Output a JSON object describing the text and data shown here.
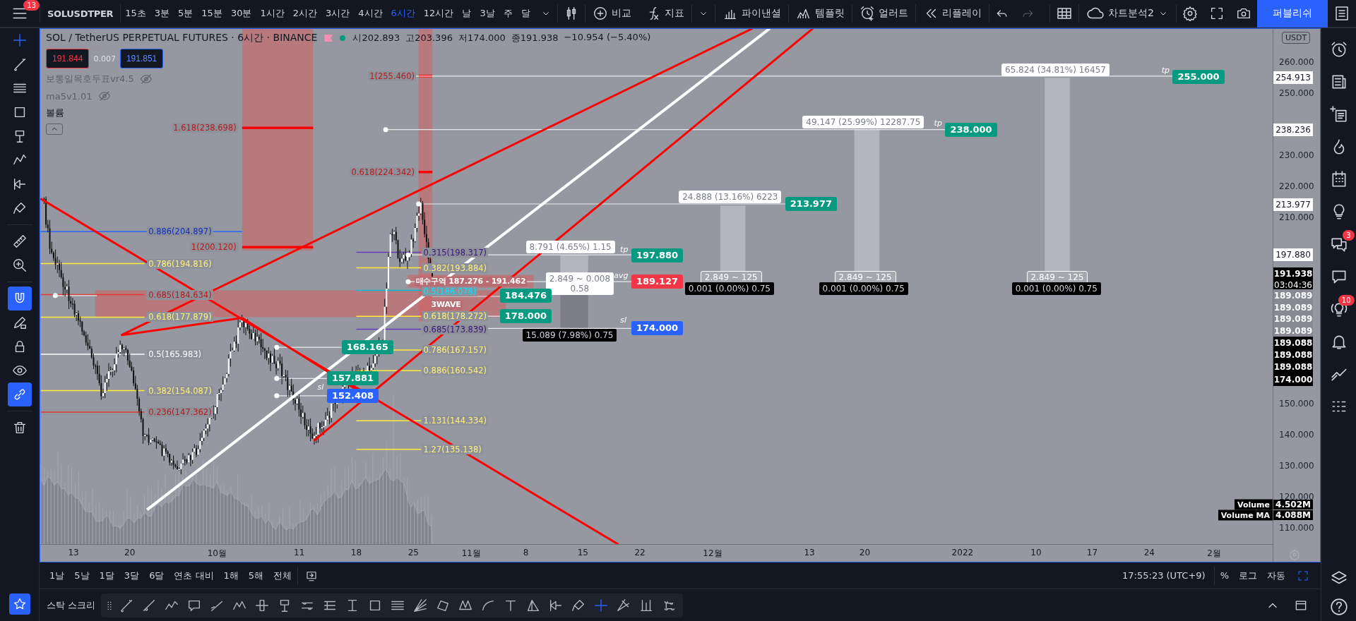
{
  "toolbar": {
    "menu_badge": "13",
    "symbol": "SOLUSDTPER",
    "intervals": [
      {
        "label": "15초",
        "selected": false
      },
      {
        "label": "3분",
        "selected": false
      },
      {
        "label": "5분",
        "selected": false
      },
      {
        "label": "15분",
        "selected": false
      },
      {
        "label": "30분",
        "selected": false
      },
      {
        "label": "1시간",
        "selected": false
      },
      {
        "label": "2시간",
        "selected": false
      },
      {
        "label": "3시간",
        "selected": false
      },
      {
        "label": "4시간",
        "selected": false
      },
      {
        "label": "6시간",
        "selected": true
      },
      {
        "label": "12시간",
        "selected": false
      },
      {
        "label": "날",
        "selected": false
      },
      {
        "label": "3날",
        "selected": false
      },
      {
        "label": "주",
        "selected": false
      },
      {
        "label": "달",
        "selected": false
      }
    ],
    "buttons": [
      {
        "kind": "compare",
        "label": "비교"
      },
      {
        "kind": "indicator",
        "label": "지표"
      },
      {
        "kind": "financial",
        "label": "파이낸셜"
      },
      {
        "kind": "template",
        "label": "템플릿"
      },
      {
        "kind": "alert",
        "label": "얼러트"
      },
      {
        "kind": "replay",
        "label": "리플레이"
      }
    ],
    "layout_name": "차트분석2",
    "publish": "퍼블리쉬"
  },
  "left_tools": [
    {
      "kind": "crosshair",
      "selected": true
    },
    {
      "kind": "line",
      "selected": false
    },
    {
      "kind": "fib",
      "selected": false
    },
    {
      "kind": "rect",
      "selected": false
    },
    {
      "kind": "signpost",
      "selected": false
    },
    {
      "kind": "pattern",
      "selected": false
    },
    {
      "kind": "forecast",
      "selected": false
    },
    {
      "kind": "brush",
      "selected": false
    },
    {
      "kind": "ruler",
      "selected": false
    },
    {
      "kind": "zoom",
      "selected": false
    }
  ],
  "toggles": [
    {
      "kind": "magnet",
      "on": true
    },
    {
      "kind": "pencil-lock",
      "on": false
    },
    {
      "kind": "lock",
      "on": false
    },
    {
      "kind": "eye",
      "on": false
    },
    {
      "kind": "link",
      "on": true
    }
  ],
  "chart": {
    "title": "SOL / TetherUS PERPETUAL FUTURES · 6시간 · BINANCE",
    "ohlc": [
      {
        "label": "시",
        "value": "202.893"
      },
      {
        "label": "고",
        "value": "203.396"
      },
      {
        "label": "저",
        "value": "174.000"
      },
      {
        "label": "종",
        "value": "191.938"
      }
    ],
    "change": "−10.954 (−5.40%)",
    "sell": "191.844",
    "spread": "0.007",
    "buy": "191.851",
    "indicators": [
      {
        "name": "보통일목호두표vr4.5",
        "hidden": true
      },
      {
        "name": "ma5v1.01",
        "hidden": true
      }
    ],
    "volume_pane": "볼륨",
    "annotations": [
      {
        "kind": "fib-blue",
        "text": "0.886(204.897)"
      },
      {
        "kind": "fib-yellow",
        "text": "0.786(194.816)"
      },
      {
        "kind": "fib-red",
        "text": "0.685(184.634)"
      },
      {
        "kind": "fib-yellow",
        "text": "0.618(177.879)"
      },
      {
        "kind": "fib-white",
        "text": "0.5(165.983)"
      },
      {
        "kind": "fib-yellow",
        "text": "0.382(154.087)"
      },
      {
        "kind": "fib-red",
        "text": "0.236(147.362)"
      },
      {
        "kind": "fib-red",
        "text": "1.618(238.698)"
      },
      {
        "kind": "fib-red",
        "text": "1(200.120)"
      },
      {
        "kind": "fib-red",
        "text": "1(255.460)"
      },
      {
        "kind": "fib-red",
        "text": "0.618(224.342)"
      },
      {
        "kind": "fib-purple",
        "text": "0.315(198.317)"
      },
      {
        "kind": "fib-yellow",
        "text": "0.382(193.884)"
      },
      {
        "kind": "zone",
        "text": "매수구역 187.276 - 191.462"
      },
      {
        "kind": "fib-cyan",
        "text": "0.5(186.078)"
      },
      {
        "kind": "zone",
        "text": "3WAVE"
      },
      {
        "kind": "fib-yellow",
        "text": "0.618(178.272)"
      },
      {
        "kind": "fib-purple",
        "text": "0.685(173.839)"
      },
      {
        "kind": "fib-yellow",
        "text": "0.786(167.157)"
      },
      {
        "kind": "fib-yellow",
        "text": "0.886(160.542)"
      },
      {
        "kind": "fib-yellow",
        "text": "1.131(144.334)"
      },
      {
        "kind": "fib-yellow",
        "text": "1.27(135.138)"
      },
      {
        "kind": "stat-white",
        "text": "8.791 (4.65%) 1.15"
      },
      {
        "kind": "tag",
        "text": "tp"
      },
      {
        "kind": "target",
        "text": "197.880"
      },
      {
        "kind": "stat-white",
        "text": "2.849 ~ 0.008\n0.58"
      },
      {
        "kind": "tag",
        "text": "avg"
      },
      {
        "kind": "avg",
        "text": "189.127"
      },
      {
        "kind": "target",
        "text": "184.476"
      },
      {
        "kind": "target",
        "text": "178.000"
      },
      {
        "kind": "tag",
        "text": "sl"
      },
      {
        "kind": "stop",
        "text": "174.000"
      },
      {
        "kind": "stat-black",
        "text": "15.089 (7.98%) 0.75"
      },
      {
        "kind": "stat-white",
        "text": "24.888 (13.16%) 6223"
      },
      {
        "kind": "target",
        "text": "213.977"
      },
      {
        "kind": "stat-grey",
        "text": "2.849 ~ 125"
      },
      {
        "kind": "stat-black",
        "text": "0.001 (0.00%) 0.75"
      },
      {
        "kind": "stat-white",
        "text": "49.147 (25.99%) 12287.75"
      },
      {
        "kind": "tag",
        "text": "tp"
      },
      {
        "kind": "target",
        "text": "238.000"
      },
      {
        "kind": "stat-grey",
        "text": "2.849 ~ 125"
      },
      {
        "kind": "stat-black",
        "text": "0.001 (0.00%) 0.75"
      },
      {
        "kind": "stat-white",
        "text": "65.824 (34.81%) 16457"
      },
      {
        "kind": "tag",
        "text": "tp"
      },
      {
        "kind": "target",
        "text": "255.000"
      },
      {
        "kind": "stat-grey",
        "text": "2.849 ~ 125"
      },
      {
        "kind": "stat-black",
        "text": "0.001 (0.00%) 0.75"
      },
      {
        "kind": "target",
        "text": "168.165"
      },
      {
        "kind": "target",
        "text": "157.881"
      },
      {
        "kind": "stop",
        "text": "152.408"
      },
      {
        "kind": "tag",
        "text": "sl"
      }
    ],
    "volume_labels": [
      {
        "name": "Volume",
        "value": "4.502M"
      },
      {
        "name": "Volume MA",
        "value": "4.088M"
      }
    ]
  },
  "price_axis": {
    "unit": "USDT",
    "ticks": [
      "260.000",
      "250.000",
      "230.000",
      "220.000",
      "210.000",
      "150.000",
      "140.000",
      "130.000",
      "120.000",
      "110.000"
    ],
    "labels": [
      {
        "kind": "line",
        "text": "254.913"
      },
      {
        "kind": "line",
        "text": "238.236"
      },
      {
        "kind": "line",
        "text": "213.977"
      },
      {
        "kind": "line",
        "text": "197.880"
      },
      {
        "kind": "last",
        "text": "191.938",
        "countdown": "03:04:36"
      },
      {
        "kind": "order",
        "text": "189.089"
      },
      {
        "kind": "order",
        "text": "189.089"
      },
      {
        "kind": "order",
        "text": "189.089"
      },
      {
        "kind": "order",
        "text": "189.089"
      },
      {
        "kind": "position",
        "text": "189.088"
      },
      {
        "kind": "position",
        "text": "189.088"
      },
      {
        "kind": "position",
        "text": "189.088"
      },
      {
        "kind": "position",
        "text": "174.000"
      }
    ]
  },
  "time_axis": [
    "13",
    "20",
    "10월",
    "11",
    "18",
    "25",
    "11월",
    "8",
    "15",
    "22",
    "12월",
    "13",
    "20",
    "2022",
    "10",
    "17",
    "24",
    "2월"
  ],
  "bottom_bar": {
    "ranges": [
      "1날",
      "5날",
      "1달",
      "3달",
      "6달",
      "연초 대비",
      "1해",
      "5해",
      "전체"
    ],
    "clock": "17:55:23 (UTC+9)",
    "scale": [
      "%",
      "로그",
      "자동"
    ]
  },
  "drawing_bar": {
    "label": "스탁 스크리",
    "tools": [
      {
        "kind": "line",
        "selected": false
      },
      {
        "kind": "ray",
        "selected": false
      },
      {
        "kind": "path",
        "selected": false
      },
      {
        "kind": "callout",
        "selected": false
      },
      {
        "kind": "trend",
        "selected": false
      },
      {
        "kind": "abc",
        "selected": false
      },
      {
        "kind": "hline",
        "selected": false
      },
      {
        "kind": "signpost",
        "selected": false
      },
      {
        "kind": "channel",
        "selected": false
      },
      {
        "kind": "channel2",
        "selected": false
      },
      {
        "kind": "ibeam",
        "selected": false
      },
      {
        "kind": "rect",
        "selected": false
      },
      {
        "kind": "fib",
        "selected": false
      },
      {
        "kind": "fan",
        "selected": false
      },
      {
        "kind": "polygon",
        "selected": false
      },
      {
        "kind": "xabcd",
        "selected": false
      },
      {
        "kind": "curve",
        "selected": false
      },
      {
        "kind": "text",
        "selected": false
      },
      {
        "kind": "triangle",
        "selected": false
      },
      {
        "kind": "forecast",
        "selected": false
      },
      {
        "kind": "brush",
        "selected": false
      },
      {
        "kind": "crosshair",
        "selected": true
      },
      {
        "kind": "pitchfork",
        "selected": false
      },
      {
        "kind": "range",
        "selected": false
      },
      {
        "kind": "nodes",
        "selected": false
      }
    ]
  },
  "sidebar": [
    {
      "kind": "alarm"
    },
    {
      "kind": "news"
    },
    {
      "kind": "watchlist"
    },
    {
      "kind": "fire"
    },
    {
      "kind": "calendar"
    },
    {
      "kind": "bulb"
    },
    {
      "kind": "chat",
      "badge": "3"
    },
    {
      "kind": "chat-single"
    },
    {
      "kind": "idea",
      "badge": "10"
    },
    {
      "kind": "bell"
    },
    {
      "kind": "zigzag"
    },
    {
      "kind": "dots"
    }
  ]
}
